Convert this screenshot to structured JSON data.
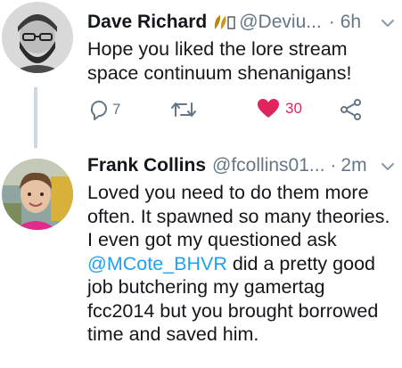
{
  "tweet1": {
    "name": "Dave Richard",
    "badge_icon": "leaf-and-pumpkin-emoji",
    "handle": "@Deviu...",
    "separator": "·",
    "time": "6h",
    "text": "Hope you liked the lore stream space continuum shenanigans!",
    "replies": "7",
    "likes": "30"
  },
  "tweet2": {
    "name": "Frank Collins",
    "handle": "@fcollins01...",
    "separator": "·",
    "time": "2m",
    "text_part1": "Loved you need to do them more often. It spawned so many theories. I even got my questioned ask ",
    "mention": "@MCote_BHVR",
    "text_part2": " did a pretty good job butchering my gamertag fcc2014 but you brought borrowed time and saved him."
  },
  "colors": {
    "text": "#14171a",
    "secondary": "#657786",
    "link": "#1da1f2",
    "like": "#e0245e",
    "thread_line": "#cfd6dc"
  }
}
